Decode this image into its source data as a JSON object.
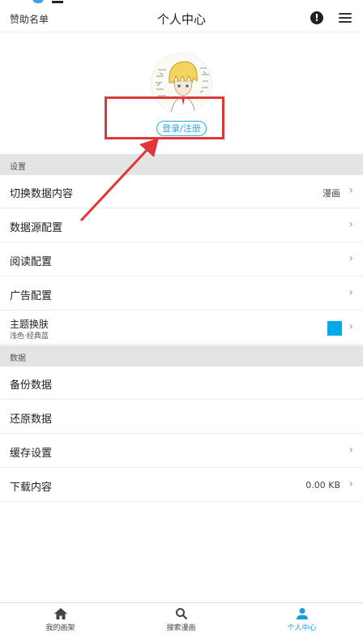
{
  "header": {
    "left_link": "赞助名单",
    "title": "个人中心",
    "info_icon": "info-icon",
    "menu_icon": "menu-icon"
  },
  "profile": {
    "login_label": "登录/注册"
  },
  "sections": {
    "settings": "设置",
    "data": "数据"
  },
  "settings_items": [
    {
      "label": "切换数据内容",
      "value": "漫画"
    },
    {
      "label": "数据源配置"
    },
    {
      "label": "阅读配置"
    },
    {
      "label": "广告配置"
    },
    {
      "label": "主题换肤",
      "sub": "浅色·经典蓝",
      "swatch_color": "#04a9ea"
    }
  ],
  "data_items": [
    {
      "label": "备份数据"
    },
    {
      "label": "还原数据"
    },
    {
      "label": "缓存设置"
    },
    {
      "label": "下载内容",
      "value": "0.00 KB"
    }
  ],
  "tabbar": {
    "tabs": [
      {
        "label": "我的画架",
        "icon": "home-icon"
      },
      {
        "label": "搜索漫画",
        "icon": "search-icon"
      },
      {
        "label": "个人中心",
        "icon": "person-icon"
      }
    ],
    "active_color": "#1d9be0"
  },
  "annotation_color": "#e0373b"
}
